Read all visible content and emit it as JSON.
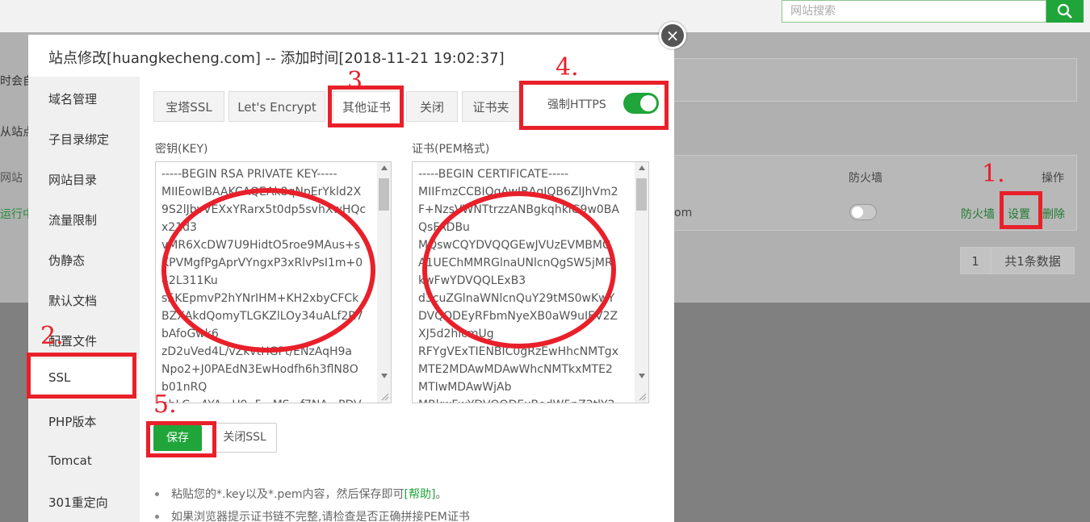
{
  "background": {
    "search_placeholder": "网站搜索",
    "left_texts": [
      "时会自",
      "从站点",
      "网站",
      "运行中"
    ],
    "firewall_header": "防火墙",
    "action_header": "操作",
    "domain_suffix": "om",
    "row_firewall_link": "防火墙",
    "row_settings_link": "设置",
    "row_delete_link": "删除",
    "page_number": "1",
    "total_label": "共1条数据"
  },
  "modal": {
    "title": "站点修改[huangkecheng.com] -- 添加时间[2018-11-21 19:02:37]",
    "close_symbol": "×",
    "sidebar": [
      "域名管理",
      "子目录绑定",
      "网站目录",
      "流量限制",
      "伪静态",
      "默认文档",
      "配置文件",
      "SSL",
      "PHP版本",
      "Tomcat",
      "301重定向"
    ],
    "active_sidebar": "SSL",
    "tabs": [
      "宝塔SSL",
      "Let's Encrypt",
      "其他证书",
      "关闭",
      "证书夹"
    ],
    "active_tab": "其他证书",
    "force_https_label": "强制HTTPS",
    "force_https_enabled": true,
    "key_label": "密钥(KEY)",
    "key_text": "-----BEGIN RSA PRIVATE KEY-----\nMIIEowIBAAKCAQEAk8qNpErYkld2X\n9S2lJbvVEXxYRarx5t0dp5svhXwHQc\nx21d3\nvMR6XcDW7U9HidtO5roe9MAus+s\nKPVMgfPgAprVYngxP3xRlvPsI1m+0\n42L311Ku\ns5KEpmvP2hYNrIHM+KH2xbyCFCk\nBZXAkdQomyTLGKZlLOy34uALf2R7\nbAfoGwk6\nzD2uVed4L/vZkvtHGPt/ENzAqH9a\nNpo2+J0PAEdN3EwHodfh6h3flN8O\nb01nRQ\nohLC...4YA...U9..5...MS...f7NA...PDV",
    "cert_label": "证书(PEM格式)",
    "cert_text": "-----BEGIN CERTIFICATE-----\nMIIFmzCCBIOgAwIBAgIQB6ZlJhVm2\nF+NzsVWNTtrzzANBgkqhkiG9w0BA\nQsFADBu\nMQswCQYDVQQGEwJVUzEVMBMG\nA1UEChMMRGlnaUNlcnQgSW5jMR\nkwFwYDVQQLExB3\nd3cuZGlnaWNlcnQuY29tMS0wKwY\nDVQQDEyRFbmNyeXB0aW9uIEV2Z\nXJ5d2hlcmUg\nRFYgVExTIENBIC0gRzEwHhcNMTgx\nMTE2MDAwMDAwWhcNMTkxMTE2\nMTIwMDAwWjAb\nMRkwFwYDVQQDExBodW5nZ2tlY2",
    "save_button": "保存",
    "close_ssl_button": "关闭SSL",
    "tips": [
      {
        "text": "粘贴您的*.key以及*.pem内容，然后保存即可",
        "link": "[帮助]",
        "suffix": "。"
      },
      {
        "text": "如果浏览器提示证书链不完整,请检查是否正确拼接PEM证书",
        "link": "",
        "suffix": ""
      }
    ]
  },
  "annotations": {
    "numbers": [
      "1.",
      "2.",
      "3.",
      "4.",
      "5."
    ],
    "color": "#e8202a"
  },
  "colors": {
    "accent": "#20a53a",
    "annotation": "#e8202a"
  }
}
